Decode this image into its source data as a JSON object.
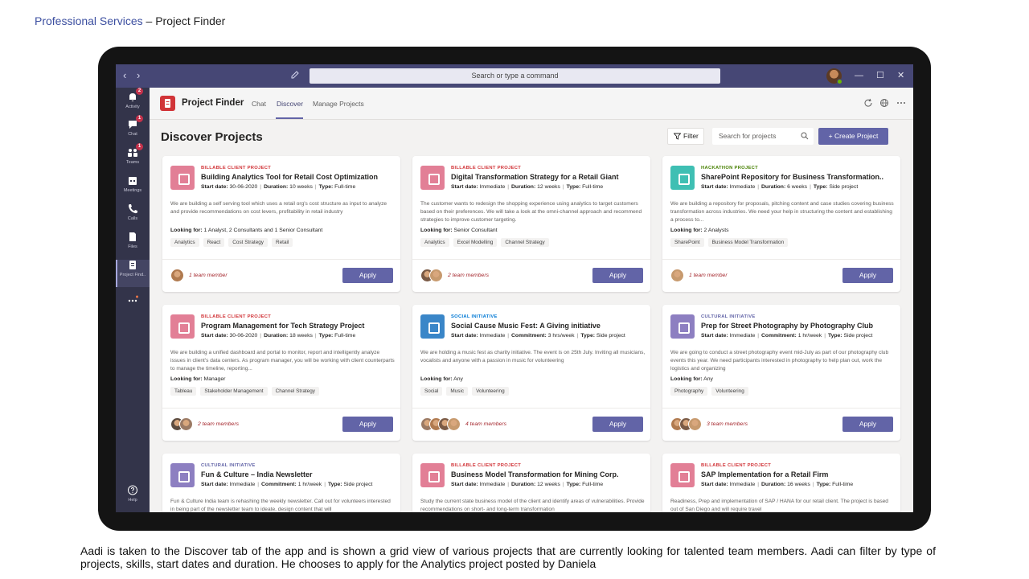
{
  "slide": {
    "brand": "Professional Services",
    "title_rest": " – Project Finder",
    "caption": "Aadi is taken to the Discover tab of the app and is shown a grid view of various projects that are currently looking for talented team members. Aadi can filter by type of projects, skills, start dates and duration. He chooses to apply for the Analytics project posted by Daniela"
  },
  "titlebar": {
    "search_placeholder": "Search or type a command",
    "back": "‹",
    "forward": "›",
    "minimize": "—",
    "maximize": "☐",
    "close": "✕"
  },
  "rail": [
    {
      "label": "Activity",
      "icon": "bell-icon",
      "badge": "2"
    },
    {
      "label": "Chat",
      "icon": "chat-icon",
      "badge": "1"
    },
    {
      "label": "Teams",
      "icon": "teams-icon",
      "badge": "1"
    },
    {
      "label": "Meetings",
      "icon": "calendar-icon",
      "badge": ""
    },
    {
      "label": "Calls",
      "icon": "phone-icon",
      "badge": ""
    },
    {
      "label": "Files",
      "icon": "files-icon",
      "badge": ""
    },
    {
      "label": "Project Find..",
      "icon": "project-finder-icon",
      "badge": ""
    },
    {
      "label": "Help",
      "icon": "help-icon",
      "badge": ""
    }
  ],
  "app": {
    "name": "Project Finder",
    "tabs": [
      "Chat",
      "Discover",
      "Manage Projects"
    ]
  },
  "toolbar": {
    "heading": "Discover Projects",
    "filter_label": "Filter",
    "search_placeholder": "Search for projects",
    "create_label": "+ Create Project"
  },
  "labels": {
    "start_date": "Start date:",
    "duration": "Duration:",
    "commitment": "Commitment:",
    "type": "Type:",
    "looking_for": "Looking for:",
    "apply": "Apply"
  },
  "colors": {
    "billable": "#d13438",
    "social": "#0078d4",
    "cultural": "#6264a7",
    "hackathon": "#498205",
    "icon_pink": "#e27f96",
    "icon_blue": "#3a86c8",
    "icon_purple": "#8d7fc1",
    "icon_teal": "#3fbfb3"
  },
  "cards": [
    {
      "type": "BILLABLE CLIENT PROJECT",
      "title": "Building Analytics Tool for Retail Cost Optimization",
      "start_date": "30-06-2020",
      "length_label": "Duration:",
      "length": "10 weeks",
      "project_type": "Full-time",
      "description": "We are building a self serving tool which uses a retail org's cost structure as input to analyze and provide recommendations on cost levers, profitability in retail industry",
      "looking_for": "1 Analyst, 2 Consultants and 1 Senior Consultant",
      "tags": [
        "Analytics",
        "React",
        "Cost Strategy",
        "Retail"
      ],
      "members": "1 team member",
      "avatar_count": 1
    },
    {
      "type": "BILLABLE CLIENT PROJECT",
      "title": "Digital Transformation Strategy for a Retail Giant",
      "start_date": "Immediate",
      "length_label": "Duration:",
      "length": "12 weeks",
      "project_type": "Full-time",
      "description": "The customer wants to redesign the shopping experience using analytics to target customers based on their preferences. We will take a look at the omni-channel approach and recommend strategies to improve customer targeting.",
      "looking_for": "Senior Consultant",
      "tags": [
        "Analytics",
        "Excel Modelling",
        "Channel Strategy"
      ],
      "members": "2 team members",
      "avatar_count": 2
    },
    {
      "type": "HACKATHON PROJECT",
      "title": "SharePoint Repository for Business Transformation..",
      "start_date": "Immediate",
      "length_label": "Duration:",
      "length": "6 weeks",
      "project_type": "Side project",
      "description": "We are building a repository for proposals, pitching content and case studies covering business transformation across industries. We need your help in structuring the content and establishing a process to...",
      "looking_for": "2 Analysts",
      "tags": [
        "SharePoint",
        "Business Model Transformation"
      ],
      "members": "1 team member",
      "avatar_count": 1
    },
    {
      "type": "BILLABLE CLIENT PROJECT",
      "title": "Program Management for Tech Strategy Project",
      "start_date": "30-06-2020",
      "length_label": "Duration:",
      "length": "18 weeks",
      "project_type": "Full-time",
      "description": "We are building a unified dashboard and portal to monitor, report and intelligently analyze issues in client's data centers. As program manager, you will be working with client counterparts to manage the timeline, reporting...",
      "looking_for": "Manager",
      "tags": [
        "Tableau",
        "Stakeholder Management",
        "Channel Strategy"
      ],
      "members": "2 team members",
      "avatar_count": 2
    },
    {
      "type": "SOCIAL INITIATIVE",
      "title": "Social Cause Music Fest: A Giving initiative",
      "start_date": "Immediate",
      "length_label": "Commitment:",
      "length": "3 hrs/week",
      "project_type": "Side project",
      "description": "We are holding a music fest as charity initiative. The event is on 25th July. Inviting all musicians, vocalists and anyone with a passion in music for volunteering",
      "looking_for": "Any",
      "tags": [
        "Social",
        "Music",
        "Volunteering"
      ],
      "members": "4 team members",
      "avatar_count": 4
    },
    {
      "type": "CULTURAL INITIATIVE",
      "title": "Prep for Street Photography by Photography Club",
      "start_date": "Immediate",
      "length_label": "Commitment:",
      "length": "1 hr/week",
      "project_type": "Side project",
      "description": "We are going to conduct a street photography event mid-July as part of our photography club events this year. We need participants interested in photography to help plan out, work the logistics and organizing",
      "looking_for": "Any",
      "tags": [
        "Photography",
        "Volunteering"
      ],
      "members": "3 team members",
      "avatar_count": 3
    },
    {
      "type": "CULTURAL INITIATIVE",
      "title": "Fun & Culture – India Newsletter",
      "start_date": "Immediate",
      "length_label": "Commitment:",
      "length": "1 hr/week",
      "project_type": "Side project",
      "description": "Fun & Culture India team is rehashing the weekly newsletter. Call out for volunteers interested in being part of the newsletter team to ideate, design content that will",
      "looking_for": "",
      "tags": [],
      "members": "",
      "avatar_count": 0
    },
    {
      "type": "BILLABLE CLIENT PROJECT",
      "title": "Business Model Transformation for Mining Corp.",
      "start_date": "Immediate",
      "length_label": "Duration:",
      "length": "12 weeks",
      "project_type": "Full-time",
      "description": "Study the current state business model of the client and identify areas of vulnerabilities. Provide recommendations on short- and long-term transformation",
      "looking_for": "",
      "tags": [],
      "members": "",
      "avatar_count": 0
    },
    {
      "type": "BILLABLE CLIENT PROJECT",
      "title": "SAP Implementation for a Retail Firm",
      "start_date": "Immediate",
      "length_label": "Duration:",
      "length": "16 weeks",
      "project_type": "Full-time",
      "description": "Readiness, Prep and implementation of SAP / HANA for our retail client. The project is based out of San Diego and will require travel",
      "looking_for": "",
      "tags": [],
      "members": "",
      "avatar_count": 0
    }
  ]
}
